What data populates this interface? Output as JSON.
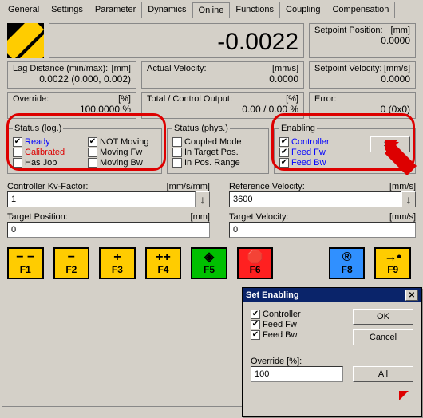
{
  "tabs": [
    "General",
    "Settings",
    "Parameter",
    "Dynamics",
    "Online",
    "Functions",
    "Coupling",
    "Compensation"
  ],
  "active_tab": "Online",
  "main_reading": "-0.0022",
  "setpoint_position": {
    "label": "Setpoint Position:",
    "unit": "[mm]",
    "value": "0.0000"
  },
  "lag_distance": {
    "label": "Lag Distance (min/max):",
    "unit": "[mm]",
    "value": "0.0022 (0.000, 0.002)"
  },
  "actual_velocity": {
    "label": "Actual Velocity:",
    "unit": "[mm/s]",
    "value": "0.0000"
  },
  "setpoint_velocity": {
    "label": "Setpoint Velocity:",
    "unit": "[mm/s]",
    "value": "0.0000"
  },
  "override": {
    "label": "Override:",
    "unit": "[%]",
    "value": "100.0000 %"
  },
  "total_control": {
    "label": "Total / Control Output:",
    "unit": "[%]",
    "value": "0.00 / 0.00 %"
  },
  "error": {
    "label": "Error:",
    "value": "0 (0x0)"
  },
  "status_log": {
    "legend": "Status (log.)",
    "ready": "Ready",
    "calibrated": "Calibrated",
    "hasjob": "Has Job",
    "notmoving": "NOT Moving",
    "movingfw": "Moving Fw",
    "movingbw": "Moving Bw"
  },
  "status_phys": {
    "legend": "Status (phys.)",
    "coupled": "Coupled Mode",
    "target": "In Target Pos.",
    "range": "In Pos. Range"
  },
  "enabling": {
    "legend": "Enabling",
    "controller": "Controller",
    "feedfw": "Feed Fw",
    "feedbw": "Feed Bw",
    "setbtn": "Set"
  },
  "kv": {
    "label": "Controller Kv-Factor:",
    "unit": "[mm/s/mm]",
    "value": "1"
  },
  "refvel": {
    "label": "Reference Velocity:",
    "unit": "[mm/s]",
    "value": "3600"
  },
  "tpos": {
    "label": "Target Position:",
    "unit": "[mm]",
    "value": "0"
  },
  "tvel": {
    "label": "Target Velocity:",
    "unit": "[mm/s]",
    "value": "0"
  },
  "fkeys": {
    "f1": {
      "icon": "− −",
      "label": "F1",
      "bg": "#ffcc00"
    },
    "f2": {
      "icon": "−",
      "label": "F2",
      "bg": "#ffcc00"
    },
    "f3": {
      "icon": "+",
      "label": "F3",
      "bg": "#ffcc00"
    },
    "f4": {
      "icon": "++",
      "label": "F4",
      "bg": "#ffcc00"
    },
    "f5": {
      "icon": "◈",
      "label": "F5",
      "bg": "#00c000"
    },
    "f6": {
      "icon": "🛑",
      "label": "F6",
      "bg": "#ff2020"
    },
    "f8": {
      "icon": "®",
      "label": "F8",
      "bg": "#3090ff"
    },
    "f9": {
      "icon": "→•",
      "label": "F9",
      "bg": "#ffcc00"
    }
  },
  "dialog": {
    "title": "Set Enabling",
    "controller": "Controller",
    "feedfw": "Feed Fw",
    "feedbw": "Feed Bw",
    "override_label": "Override [%]:",
    "override_value": "100",
    "ok": "OK",
    "cancel": "Cancel",
    "all": "All"
  }
}
